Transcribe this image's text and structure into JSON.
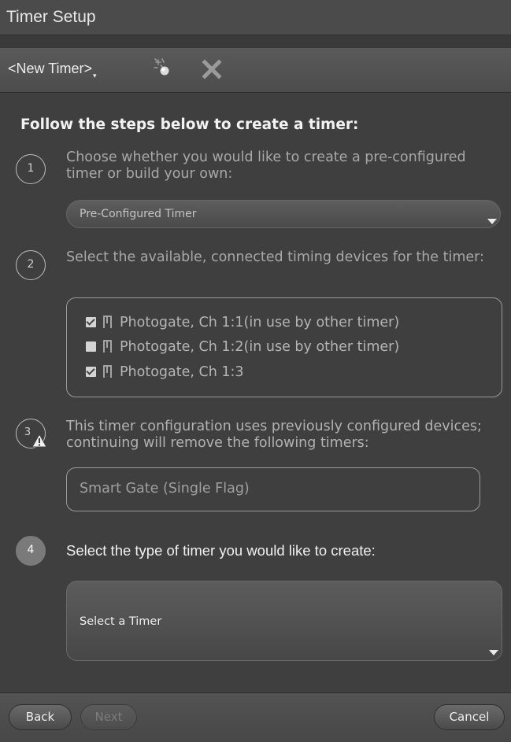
{
  "window": {
    "title": "Timer Setup"
  },
  "toolbar": {
    "timer_name": "<New Timer>",
    "caret": "▾",
    "icons": [
      "wizard-wand-icon",
      "close-icon"
    ]
  },
  "instructions": "Follow the steps below to create a timer:",
  "steps": [
    {
      "number": "1",
      "text": "Choose whether you would like to create a pre-configured timer or build your own:"
    },
    {
      "number": "2",
      "text": "Select the available, connected timing devices for the timer:"
    },
    {
      "number": "3",
      "text": "This timer configuration uses previously configured devices; continuing will remove the following timers:",
      "icon": "warning-icon"
    },
    {
      "number": "4",
      "text": "Select the type of timer you would like to create:"
    }
  ],
  "timer_source": {
    "selected": "Pre-Configured Timer"
  },
  "devices": [
    {
      "label": "Photogate, Ch 1:1(in use by other timer)",
      "checked": true,
      "icon": "photogate-icon"
    },
    {
      "label": "Photogate, Ch 1:2(in use by other timer)",
      "checked": false,
      "icon": "photogate-icon"
    },
    {
      "label": "Photogate, Ch 1:3",
      "checked": true,
      "icon": "photogate-icon"
    }
  ],
  "timers_to_remove": "Smart Gate (Single Flag)",
  "timer_type": {
    "selected": "Select a Timer"
  },
  "footer": {
    "back": "Back",
    "next": "Next",
    "cancel": "Cancel"
  },
  "colors": {
    "background": "#3f3f3f",
    "title_bar": "#4b4b4b",
    "active_step": "#7a7a7a"
  }
}
